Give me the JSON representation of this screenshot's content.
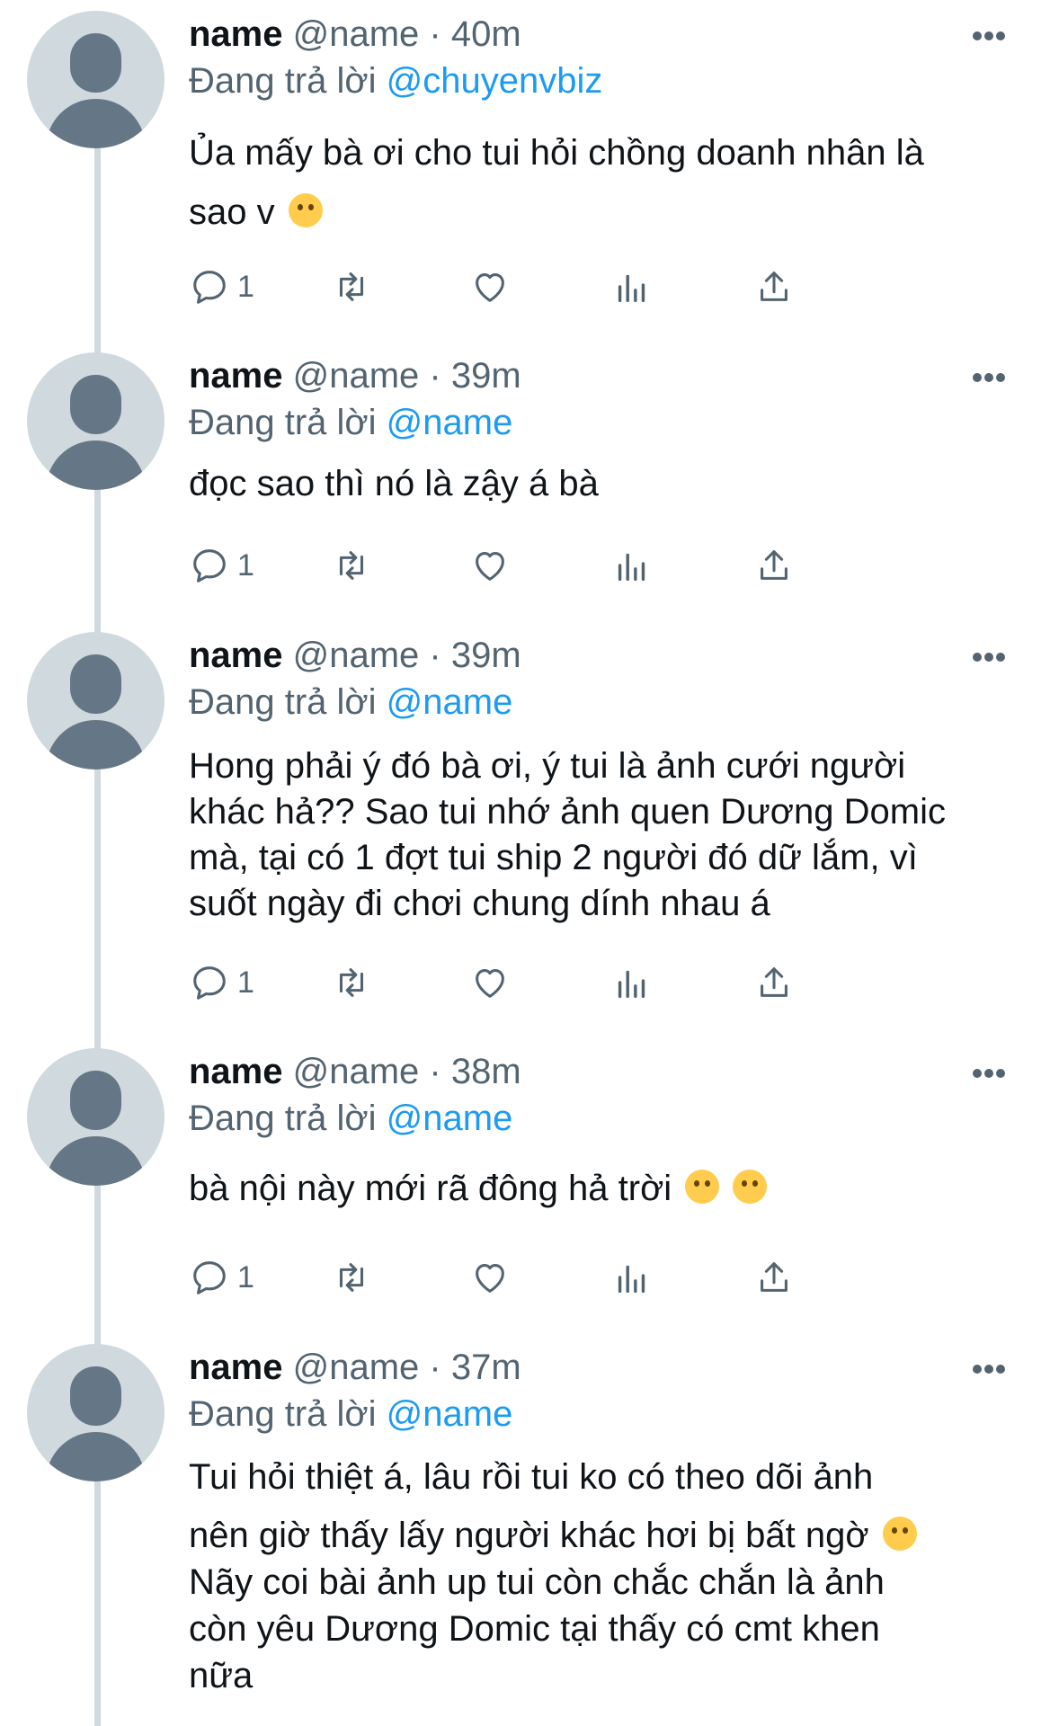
{
  "tweets": [
    {
      "name": "name",
      "meta": "@name · 40m",
      "reply_prefix": "Đang trả lời ",
      "reply_to": "@chuyenvbiz",
      "lines": [
        "Ủa mấy bà ơi cho tui hỏi chồng doanh nhân là",
        "sao v"
      ],
      "emojis": "sad-tear-emoji",
      "reply_count": "1"
    },
    {
      "name": "name",
      "meta": "@name · 39m",
      "reply_prefix": "Đang trả lời ",
      "reply_to": "@name",
      "lines": [
        "đọc sao thì nó là zậy á bà"
      ],
      "reply_count": "1"
    },
    {
      "name": "name",
      "meta": "@name · 39m",
      "reply_prefix": "Đang trả lời ",
      "reply_to": "@name",
      "lines": [
        "Hong phải ý đó bà ơi, ý tui là ảnh cưới người",
        "khác hả?? Sao tui nhớ ảnh quen Dương Domic",
        "mà, tại có 1 đợt tui ship 2 người đó dữ lắm, vì",
        "suốt ngày đi chơi chung dính nhau á"
      ],
      "reply_count": "1"
    },
    {
      "name": "name",
      "meta": "@name · 38m",
      "reply_prefix": "Đang trả lời ",
      "reply_to": "@name",
      "lines": [
        "bà nội này mới rã đông hả trời"
      ],
      "emojis": "rofl-emoji",
      "reply_count": "1"
    },
    {
      "name": "name",
      "meta": "@name · 37m",
      "reply_prefix": "Đang trả lời ",
      "reply_to": "@name",
      "lines": [
        "Tui hỏi thiệt á, lâu rồi tui ko có theo dõi ảnh",
        "nên giờ thấy lấy người khác hơi bị bất ngờ",
        "Nãy coi bài ảnh up tui còn chắc chắn là ảnh",
        "còn yêu Dương Domic tại thấy có cmt khen",
        "nữa"
      ],
      "emojis": "pleading-face-emoji"
    }
  ],
  "colors": {
    "text": "#0f1419",
    "secondary": "#536471",
    "link": "#1d9bf0",
    "avatar_bg": "#cfd9de",
    "avatar_fg": "#657786"
  },
  "icons": {
    "reply": "reply-icon",
    "retweet": "retweet-icon",
    "like": "heart-icon",
    "views": "views-icon",
    "share": "share-icon",
    "more": "more-icon"
  }
}
